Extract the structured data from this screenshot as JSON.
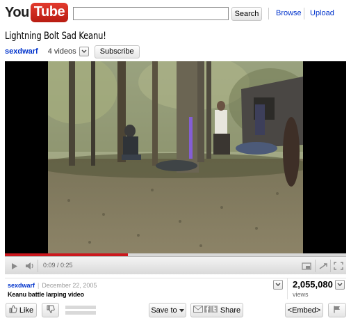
{
  "header": {
    "logo_you": "You",
    "logo_tube": "Tube",
    "search_placeholder": "",
    "search_label": "Search",
    "browse_label": "Browse",
    "upload_label": "Upload"
  },
  "video": {
    "title": "Lightning Bolt Sad Keanu!",
    "channel": "sexdwarf",
    "video_count": "4 videos",
    "subscribe_label": "Subscribe",
    "time": "0:09 / 0:25",
    "progress": 0.36
  },
  "info": {
    "uploader": "sexdwarf",
    "separator": "|",
    "date": "December 22, 2005",
    "description": "Keanu battle larping video",
    "views": "2,055,080",
    "views_label": "views"
  },
  "actions": {
    "like_label": "Like",
    "saveto_label": "Save to",
    "share_label": "Share",
    "embed_label": "<Embed>"
  },
  "icons": {
    "play": "play-icon",
    "volume": "volume-icon",
    "thumbs_up": "thumbs-up-icon",
    "thumbs_down": "thumbs-down-icon",
    "flag": "flag-icon",
    "fullscreen": "fullscreen-icon"
  },
  "colors": {
    "link": "#0033cc",
    "progress": "#cc181e",
    "logo_red": "#e33b2e"
  }
}
